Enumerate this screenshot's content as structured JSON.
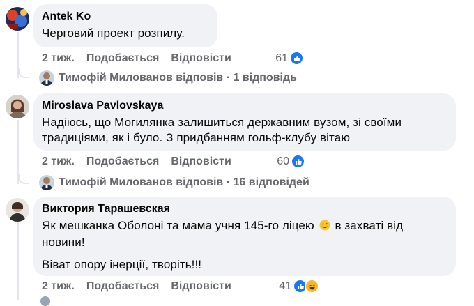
{
  "comments": [
    {
      "author": "Antek Ko",
      "text": "Черговий проект розпилу.",
      "time": "2 тиж.",
      "like_label": "Подобається",
      "reply_label": "Відповісти",
      "reaction_count": "61",
      "reactions": [
        "like-icon"
      ],
      "replies": {
        "author": "Тимофій Милованов",
        "verb": "відповів",
        "sep": "·",
        "count_label": "1 відповідь"
      }
    },
    {
      "author": "Miroslava Pavlovskaya",
      "text": "Надіюсь, що Могилянка залишиться державним вузом, зі своїми традиціями, як і було. З придбанням гольф-клубу вітаю",
      "time": "2 тиж.",
      "like_label": "Подобається",
      "reply_label": "Відповісти",
      "reaction_count": "60",
      "reactions": [
        "like-icon"
      ],
      "replies": {
        "author": "Тимофій Милованов",
        "verb": "відповів",
        "sep": "·",
        "count_label": "16 відповідей"
      }
    },
    {
      "author": "Виктория Тарашевская",
      "text_line1": "Як мешканка Оболоні та мама учня 145-го ліцею",
      "text_line1_emoji": "wink-emoji",
      "text_line1_tail": "в захваті від новини!",
      "text_line2": "Віват опору інерції, творіть!!!",
      "time": "2 тиж.",
      "like_label": "Подобається",
      "reply_label": "Відповісти",
      "reaction_count": "41",
      "reactions": [
        "like-icon",
        "haha-icon"
      ]
    }
  ],
  "colors": {
    "bubble": "#f0f2f5",
    "meta_text": "#65676b",
    "like_blue": "#1877f2",
    "haha_yellow": "#f7b928"
  }
}
